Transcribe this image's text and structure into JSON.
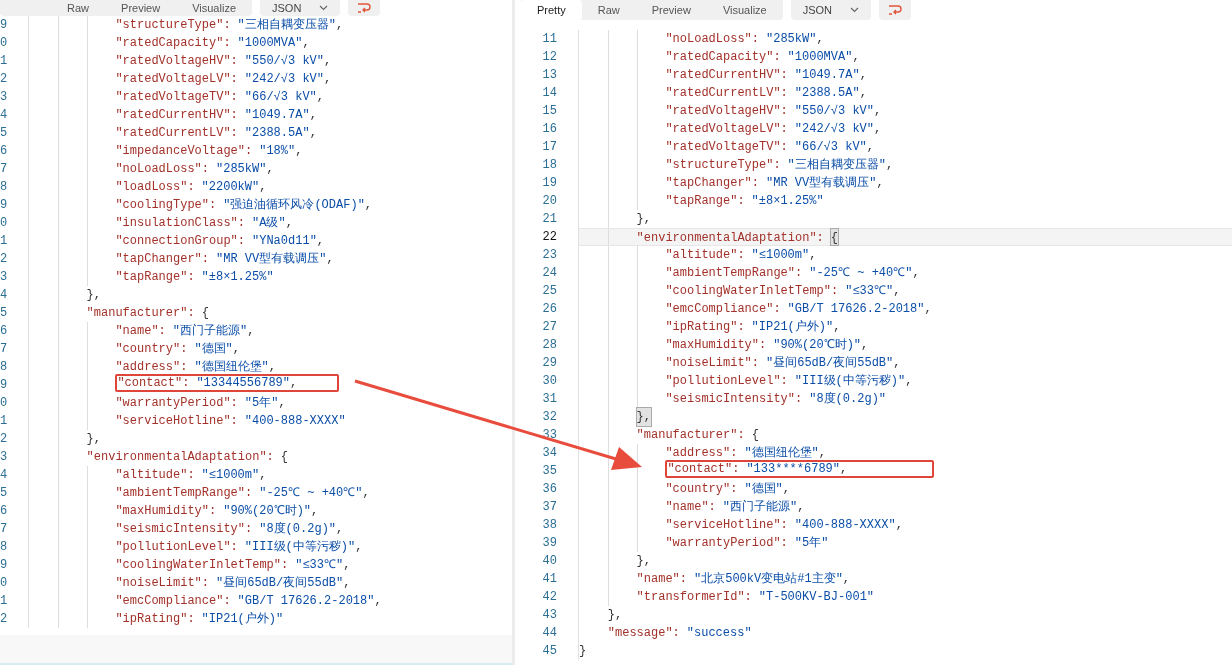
{
  "panels": [
    {
      "tabs": [
        {
          "label": "Raw",
          "selected": false
        },
        {
          "label": "Preview",
          "selected": false
        },
        {
          "label": "Visualize",
          "selected": false
        }
      ],
      "format": "JSON",
      "lines": [
        {
          "children": [
            {
              "children": [
                {
                  "children": [
                    {
                      "n": "9",
                      "key": "\"structureType\":",
                      "value": "\"三相自耦变压器\"",
                      "tail": ","
                    },
                    {
                      "n": "0",
                      "key": "\"ratedCapacity\":",
                      "value": "\"1000MVA\"",
                      "tail": ","
                    },
                    {
                      "n": "1",
                      "key": "\"ratedVoltageHV\":",
                      "value": "\"550/√3 kV\"",
                      "tail": ","
                    },
                    {
                      "n": "2",
                      "key": "\"ratedVoltageLV\":",
                      "value": "\"242/√3 kV\"",
                      "tail": ","
                    },
                    {
                      "n": "3",
                      "key": "\"ratedVoltageTV\":",
                      "value": "\"66/√3 kV\"",
                      "tail": ","
                    },
                    {
                      "n": "4",
                      "key": "\"ratedCurrentHV\":",
                      "value": "\"1049.7A\"",
                      "tail": ","
                    },
                    {
                      "n": "5",
                      "key": "\"ratedCurrentLV\":",
                      "value": "\"2388.5A\"",
                      "tail": ","
                    },
                    {
                      "n": "6",
                      "key": "\"impedanceVoltage\":",
                      "value": "\"18%\"",
                      "tail": ","
                    },
                    {
                      "n": "7",
                      "key": "\"noLoadLoss\":",
                      "value": "\"285kW\"",
                      "tail": ","
                    },
                    {
                      "n": "8",
                      "key": "\"loadLoss\":",
                      "value": "\"2200kW\"",
                      "tail": ","
                    },
                    {
                      "n": "9",
                      "key": "\"coolingType\":",
                      "value": "\"强迫油循环风冷(ODAF)\"",
                      "tail": ","
                    },
                    {
                      "n": "0",
                      "key": "\"insulationClass\":",
                      "value": "\"A级\"",
                      "tail": ","
                    },
                    {
                      "n": "1",
                      "key": "\"connectionGroup\":",
                      "value": "\"YNa0d11\"",
                      "tail": ","
                    },
                    {
                      "n": "2",
                      "key": "\"tapChanger\":",
                      "value": "\"MR VV型有载调压\"",
                      "tail": ","
                    },
                    {
                      "n": "3",
                      "key": "\"tapRange\":",
                      "value": "\"±8×1.25%\""
                    }
                  ],
                  "close_n": "4",
                  "close": "},"
                },
                {
                  "n": "5",
                  "key": "\"manufacturer\":",
                  "open": "{",
                  "children": [
                    {
                      "n": "6",
                      "key": "\"name\":",
                      "value": "\"西门子能源\"",
                      "tail": ","
                    },
                    {
                      "n": "7",
                      "key": "\"country\":",
                      "value": "\"德国\"",
                      "tail": ","
                    },
                    {
                      "n": "8",
                      "key": "\"address\":",
                      "value": "\"德国纽伦堡\"",
                      "tail": ","
                    },
                    {
                      "n": "9",
                      "key": "\"contact\":",
                      "value": "\"13344556789\"",
                      "tail": ",",
                      "boxed": true
                    },
                    {
                      "n": "0",
                      "key": "\"warrantyPeriod\":",
                      "value": "\"5年\"",
                      "tail": ","
                    },
                    {
                      "n": "1",
                      "key": "\"serviceHotline\":",
                      "value": "\"400-888-XXXX\""
                    }
                  ],
                  "close_n": "2",
                  "close": "},"
                },
                {
                  "n": "3",
                  "key": "\"environmentalAdaptation\":",
                  "open": "{",
                  "children": [
                    {
                      "n": "4",
                      "key": "\"altitude\":",
                      "value": "\"≤1000m\"",
                      "tail": ","
                    },
                    {
                      "n": "5",
                      "key": "\"ambientTempRange\":",
                      "value": "\"-25℃ ~ +40℃\"",
                      "tail": ","
                    },
                    {
                      "n": "6",
                      "key": "\"maxHumidity\":",
                      "value": "\"90%(20℃时)\"",
                      "tail": ","
                    },
                    {
                      "n": "7",
                      "key": "\"seismicIntensity\":",
                      "value": "\"8度(0.2g)\"",
                      "tail": ","
                    },
                    {
                      "n": "8",
                      "key": "\"pollutionLevel\":",
                      "value": "\"III级(中等污秽)\"",
                      "tail": ","
                    },
                    {
                      "n": "9",
                      "key": "\"coolingWaterInletTemp\":",
                      "value": "\"≤33℃\"",
                      "tail": ","
                    },
                    {
                      "n": "0",
                      "key": "\"noiseLimit\":",
                      "value": "\"昼间65dB/夜间55dB\"",
                      "tail": ","
                    },
                    {
                      "n": "1",
                      "key": "\"emcCompliance\":",
                      "value": "\"GB/T 17626.2-2018\"",
                      "tail": ","
                    },
                    {
                      "n": "2",
                      "key": "\"ipRating\":",
                      "value": "\"IP21(户外)\""
                    }
                  ]
                }
              ]
            }
          ]
        }
      ]
    },
    {
      "tabs": [
        {
          "label": "Pretty",
          "selected": true
        },
        {
          "label": "Raw",
          "selected": false
        },
        {
          "label": "Preview",
          "selected": false
        },
        {
          "label": "Visualize",
          "selected": false
        }
      ],
      "format": "JSON",
      "lines": [
        {
          "children": [
            {
              "children": [
                {
                  "children": [
                    {
                      "n": "11",
                      "key": "\"noLoadLoss\":",
                      "value": "\"285kW\"",
                      "tail": ","
                    },
                    {
                      "n": "12",
                      "key": "\"ratedCapacity\":",
                      "value": "\"1000MVA\"",
                      "tail": ","
                    },
                    {
                      "n": "13",
                      "key": "\"ratedCurrentHV\":",
                      "value": "\"1049.7A\"",
                      "tail": ","
                    },
                    {
                      "n": "14",
                      "key": "\"ratedCurrentLV\":",
                      "value": "\"2388.5A\"",
                      "tail": ","
                    },
                    {
                      "n": "15",
                      "key": "\"ratedVoltageHV\":",
                      "value": "\"550/√3 kV\"",
                      "tail": ","
                    },
                    {
                      "n": "16",
                      "key": "\"ratedVoltageLV\":",
                      "value": "\"242/√3 kV\"",
                      "tail": ","
                    },
                    {
                      "n": "17",
                      "key": "\"ratedVoltageTV\":",
                      "value": "\"66/√3 kV\"",
                      "tail": ","
                    },
                    {
                      "n": "18",
                      "key": "\"structureType\":",
                      "value": "\"三相自耦变压器\"",
                      "tail": ","
                    },
                    {
                      "n": "19",
                      "key": "\"tapChanger\":",
                      "value": "\"MR VV型有载调压\"",
                      "tail": ","
                    },
                    {
                      "n": "20",
                      "key": "\"tapRange\":",
                      "value": "\"±8×1.25%\""
                    }
                  ],
                  "close_n": "21",
                  "close": "},"
                },
                {
                  "n": "22",
                  "key": "\"environmentalAdaptation\":",
                  "open": "{",
                  "current": true,
                  "children": [
                    {
                      "n": "23",
                      "key": "\"altitude\":",
                      "value": "\"≤1000m\"",
                      "tail": ","
                    },
                    {
                      "n": "24",
                      "key": "\"ambientTempRange\":",
                      "value": "\"-25℃ ~ +40℃\"",
                      "tail": ","
                    },
                    {
                      "n": "25",
                      "key": "\"coolingWaterInletTemp\":",
                      "value": "\"≤33℃\"",
                      "tail": ","
                    },
                    {
                      "n": "26",
                      "key": "\"emcCompliance\":",
                      "value": "\"GB/T 17626.2-2018\"",
                      "tail": ","
                    },
                    {
                      "n": "27",
                      "key": "\"ipRating\":",
                      "value": "\"IP21(户外)\"",
                      "tail": ","
                    },
                    {
                      "n": "28",
                      "key": "\"maxHumidity\":",
                      "value": "\"90%(20℃时)\"",
                      "tail": ","
                    },
                    {
                      "n": "29",
                      "key": "\"noiseLimit\":",
                      "value": "\"昼间65dB/夜间55dB\"",
                      "tail": ","
                    },
                    {
                      "n": "30",
                      "key": "\"pollutionLevel\":",
                      "value": "\"III级(中等污秽)\"",
                      "tail": ","
                    },
                    {
                      "n": "31",
                      "key": "\"seismicIntensity\":",
                      "value": "\"8度(0.2g)\""
                    }
                  ],
                  "close_n": "32",
                  "close": "},"
                },
                {
                  "n": "33",
                  "key": "\"manufacturer\":",
                  "open": "{",
                  "children": [
                    {
                      "n": "34",
                      "key": "\"address\":",
                      "value": "\"德国纽伦堡\"",
                      "tail": ","
                    },
                    {
                      "n": "35",
                      "key": "\"contact\":",
                      "value": "\"133****6789\"",
                      "tail": ",",
                      "boxed": true
                    },
                    {
                      "n": "36",
                      "key": "\"country\":",
                      "value": "\"德国\"",
                      "tail": ","
                    },
                    {
                      "n": "37",
                      "key": "\"name\":",
                      "value": "\"西门子能源\"",
                      "tail": ","
                    },
                    {
                      "n": "38",
                      "key": "\"serviceHotline\":",
                      "value": "\"400-888-XXXX\"",
                      "tail": ","
                    },
                    {
                      "n": "39",
                      "key": "\"warrantyPeriod\":",
                      "value": "\"5年\""
                    }
                  ],
                  "close_n": "40",
                  "close": "},"
                },
                {
                  "n": "41",
                  "key": "\"name\":",
                  "value": "\"北京500kV变电站#1主变\"",
                  "tail": ","
                },
                {
                  "n": "42",
                  "key": "\"transformerId\":",
                  "value": "\"T-500KV-BJ-001\""
                }
              ],
              "close_n": "43",
              "close": "},"
            },
            {
              "n": "44",
              "key": "\"message\":",
              "value": "\"success\""
            }
          ],
          "close_n": "45",
          "close": "}"
        }
      ]
    }
  ]
}
